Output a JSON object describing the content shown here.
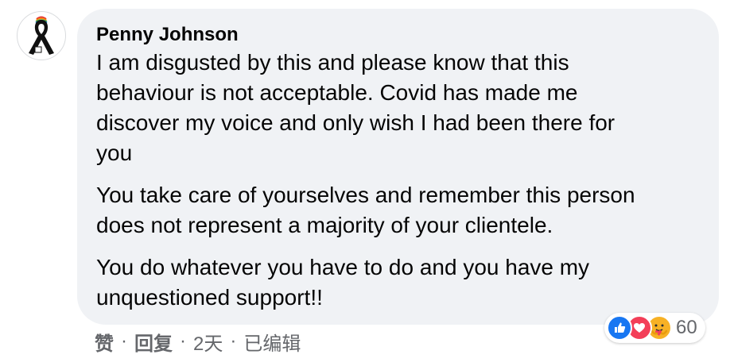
{
  "comment": {
    "author": "Penny Johnson",
    "paragraphs": [
      "I am disgusted by this and please know that this\nbehaviour is not acceptable. Covid has made me\ndiscover my voice and only wish I had been there for\nyou",
      "You take care of yourselves and remember this person\ndoes not represent a majority of your clientele.",
      "You do whatever you have to do and you have my\nunquestioned support!!"
    ]
  },
  "actions": {
    "like_label": "赞",
    "reply_label": "回复",
    "timestamp": "2天",
    "edited_label": "已编辑",
    "separator": "·"
  },
  "reactions": {
    "types": [
      "like-icon",
      "love-icon",
      "care-icon"
    ],
    "count": "60"
  },
  "colors": {
    "bubble": "#f0f2f5",
    "text": "#050505",
    "secondary_text": "#65676b",
    "like_blue": "#1877f2",
    "love_red": "#f33e58",
    "care_yellow": "#f7b125"
  }
}
